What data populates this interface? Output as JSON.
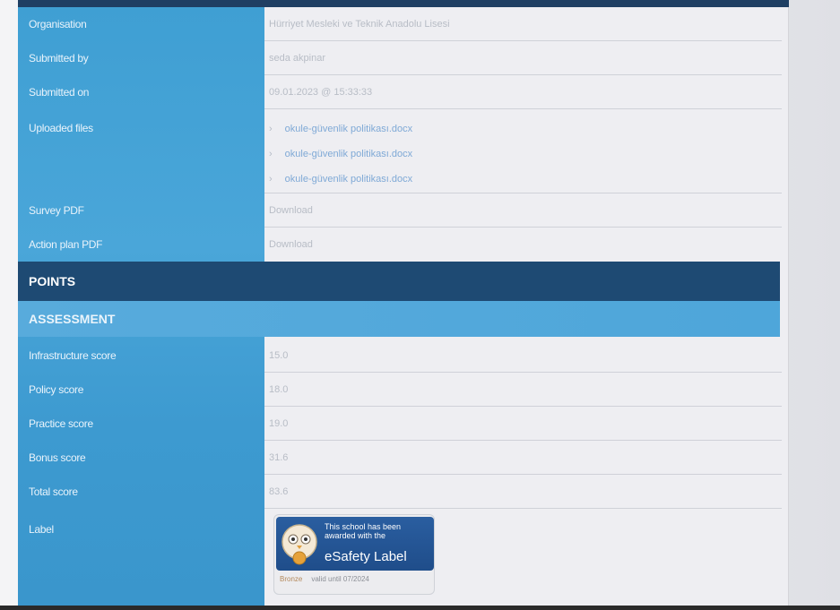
{
  "details": {
    "organisation_label": "Organisation",
    "organisation_value": "Hürriyet Mesleki ve Teknik Anadolu Lisesi",
    "submitted_by_label": "Submitted by",
    "submitted_by_value": "seda akpinar",
    "submitted_on_label": "Submitted on",
    "submitted_on_value": "09.01.2023 @ 15:33:33",
    "uploaded_files_label": "Uploaded files",
    "uploaded_files": [
      "okule-güvenlik politikası.docx",
      "okule-güvenlik politikası.docx",
      "okule-güvenlik politikası.docx"
    ],
    "file_chevron": "›",
    "survey_pdf_label": "Survey PDF",
    "survey_pdf_link": "Download",
    "action_plan_pdf_label": "Action plan PDF",
    "action_plan_pdf_link": "Download"
  },
  "points": {
    "title": "POINTS"
  },
  "assessment": {
    "title": "ASSESSMENT",
    "infrastructure_label": "Infrastructure score",
    "infrastructure_value": "15.0",
    "policy_label": "Policy score",
    "policy_value": "18.0",
    "practice_label": "Practice score",
    "practice_value": "19.0",
    "bonus_label": "Bonus score",
    "bonus_value": "31.6",
    "total_label": "Total score",
    "total_value": "83.6",
    "label_label": "Label"
  },
  "badge": {
    "line1": "This school has been awarded with the",
    "title": "eSafety Label",
    "level": "Bronze",
    "valid": "valid until 07/2024",
    "mascot_icon": "owl-mascot-icon"
  },
  "colors": {
    "label_column": "#4aa6d9",
    "points_band": "#1e4a73",
    "assessment_band": "#4ea6da",
    "badge_blue": "#1f4d8a",
    "link": "#7fa9d6"
  }
}
